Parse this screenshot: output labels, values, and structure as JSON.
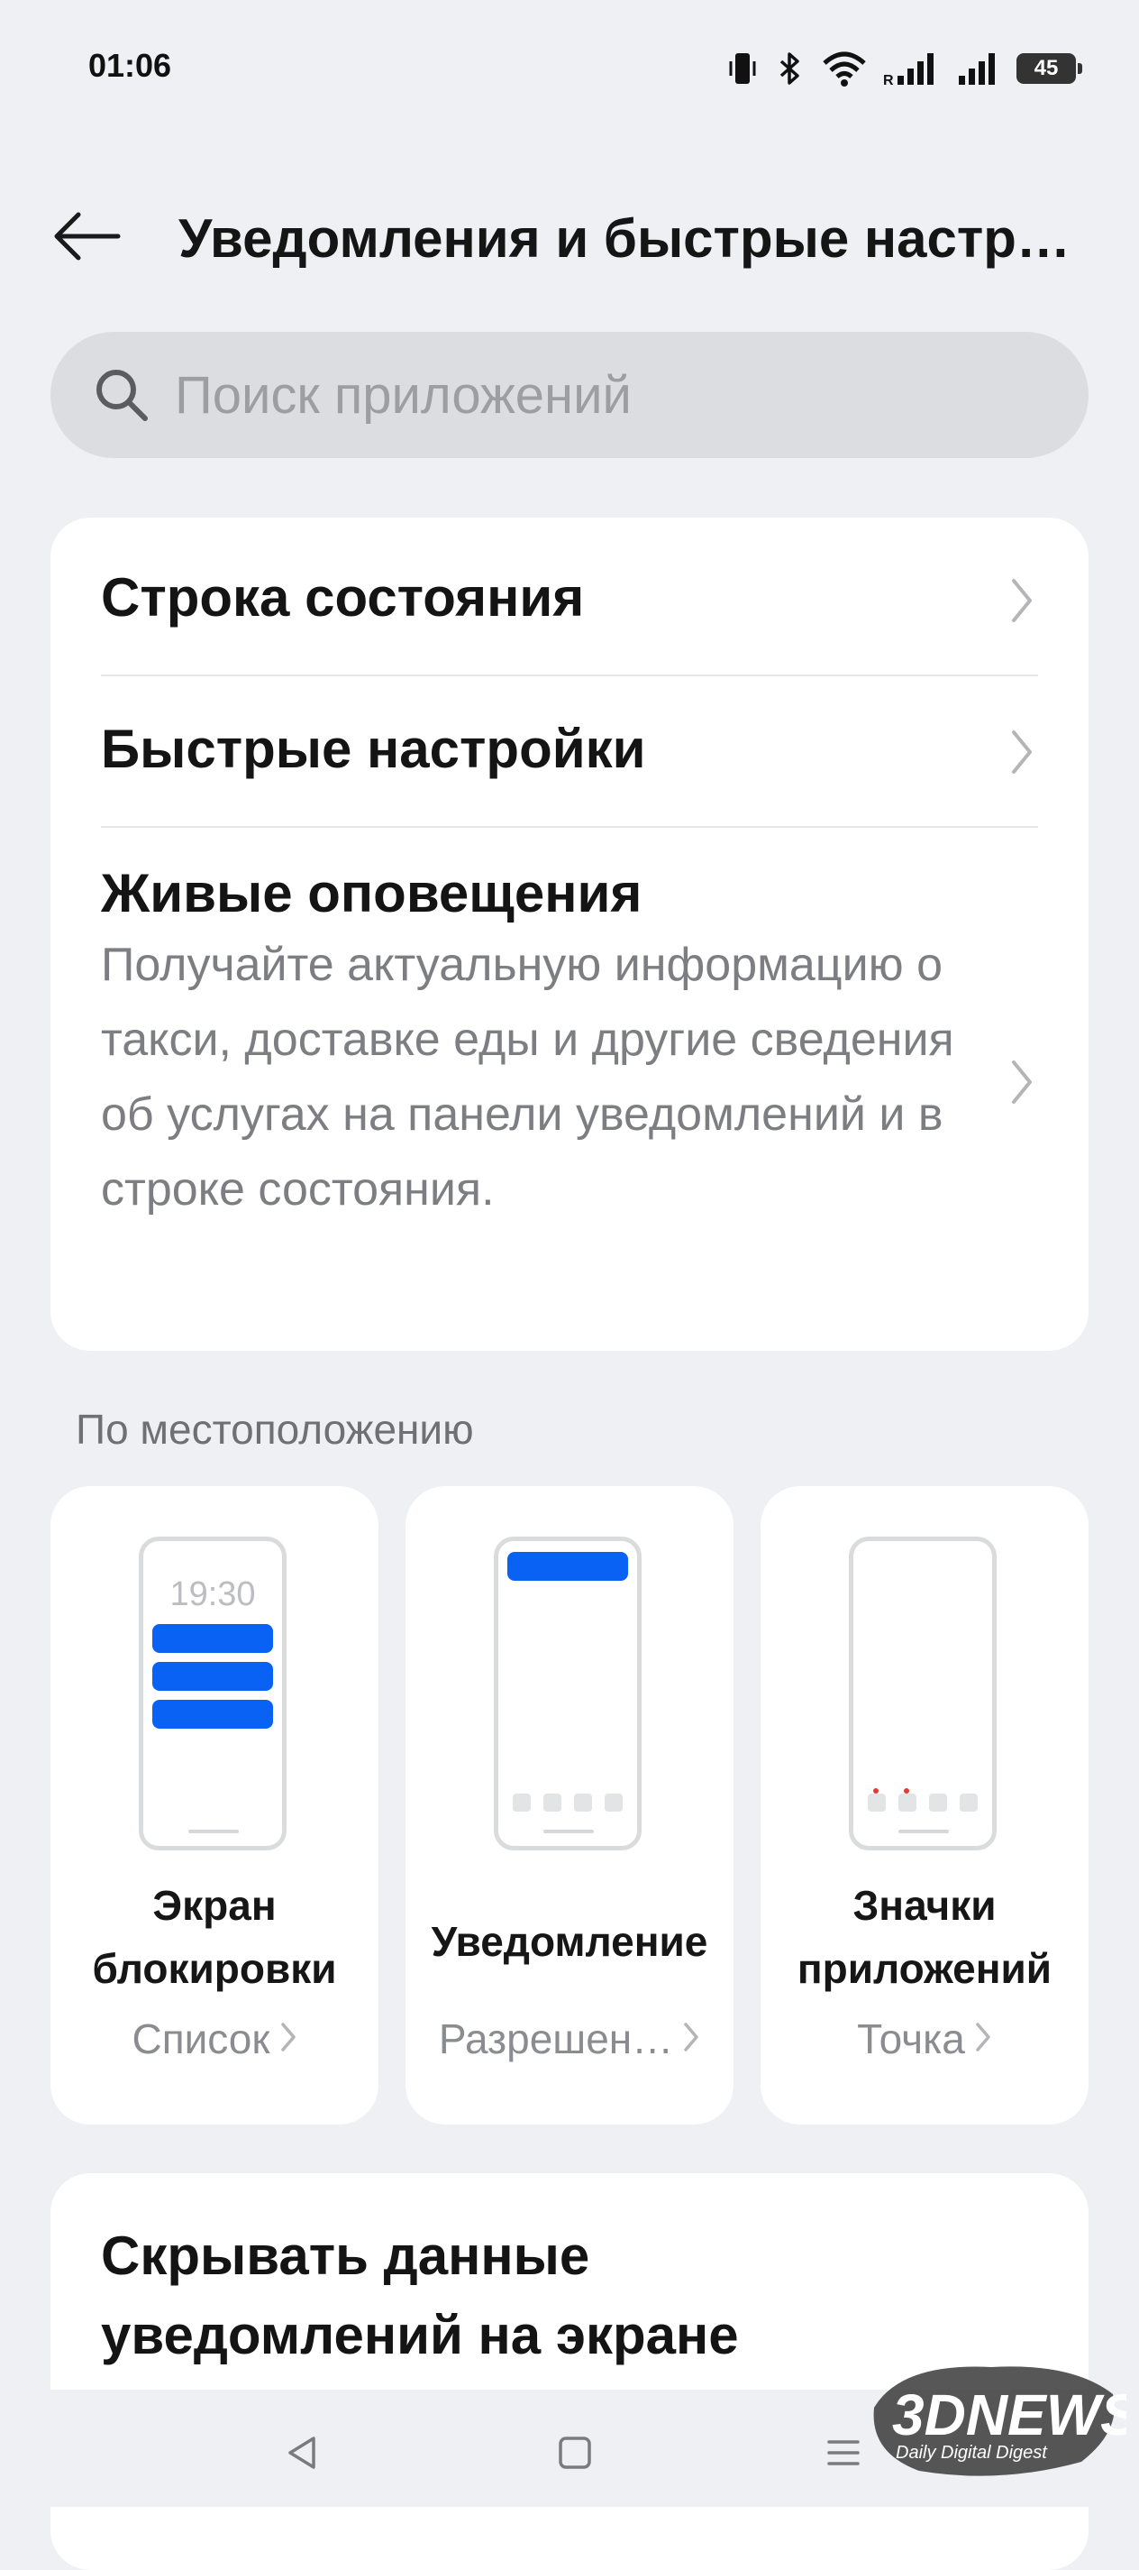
{
  "status_bar": {
    "time": "01:06",
    "battery": "45",
    "icons": [
      "vibrate-icon",
      "bluetooth-icon",
      "wifi-icon",
      "signal-icon",
      "signal-icon",
      "battery-icon"
    ]
  },
  "header": {
    "title": "Уведомления и быстрые настр…"
  },
  "search": {
    "placeholder": "Поиск приложений"
  },
  "settings_list": [
    {
      "title": "Строка состояния"
    },
    {
      "title": "Быстрые настройки"
    },
    {
      "title": "Живые оповещения",
      "subtitle": "Получайте актуальную информацию о такси, доставке еды и другие сведения об услугах на панели уведомлений и в строке состояния."
    }
  ],
  "position_section": {
    "title": "По местоположению",
    "cards": [
      {
        "label": "Экран блокировки",
        "value": "Список",
        "preview_time": "19:30"
      },
      {
        "label": "Уведомление",
        "value": "Разрешен…"
      },
      {
        "label": "Значки приложений",
        "value": "Точка"
      }
    ]
  },
  "bottom_card": {
    "title": "Скрывать данные уведомлений на экране"
  },
  "watermark": {
    "brand": "3DNEWS",
    "tagline": "Daily Digital Digest"
  },
  "colors": {
    "background": "#eff0f3",
    "card": "#ffffff",
    "accent": "#0a62f5",
    "badge_dot": "#e53935"
  }
}
